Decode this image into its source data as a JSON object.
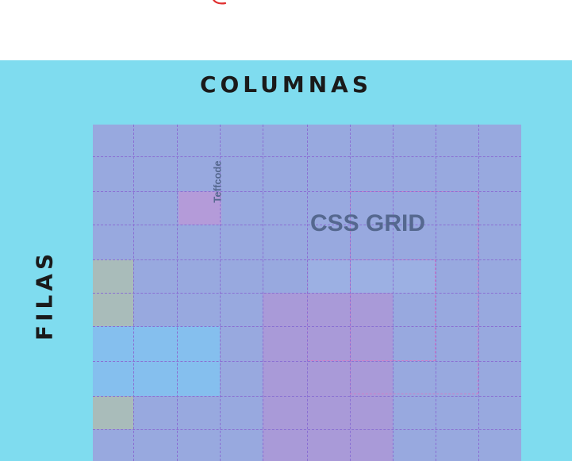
{
  "labels": {
    "columns": "COLUMNAS",
    "rows": "FILAS",
    "grid_title": "CSS GRID",
    "watermark": "Teffcode"
  },
  "colors": {
    "panel_bg": "#7fdcef",
    "grid_bg": "#98a9df",
    "grid_line": "#8a6fd3",
    "outline": "#d07fc6",
    "pink_area": "#a99ad8",
    "magenta_cell": "#b49bd9",
    "olive_cell": "#a9bcba",
    "light_blue_cell": "#85bfee",
    "text_dark": "#1a1a1a",
    "grid_text": "#55688f",
    "red_mark": "#e03030"
  },
  "grid": {
    "columns": 10,
    "rows": 10
  }
}
